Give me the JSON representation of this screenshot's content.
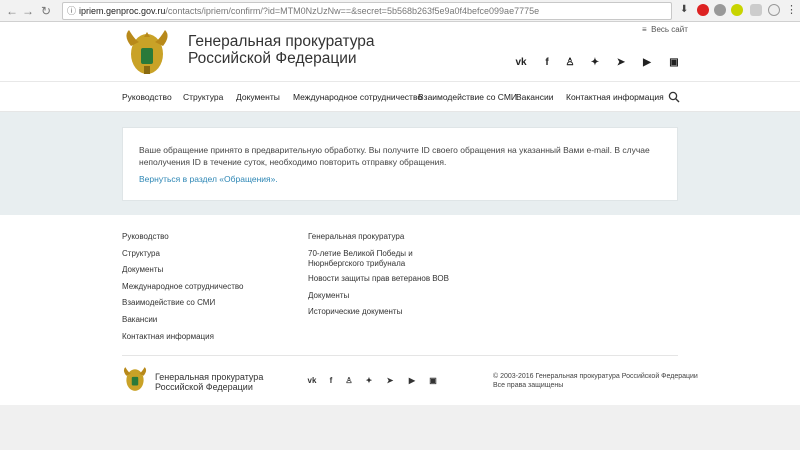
{
  "browser": {
    "url_domain": "ipriem.genproc.gov.ru",
    "url_path": "/contacts/ipriem/confirm/?id=MTM0NzUzNw==&secret=5b568b263f5e9a0f4befce099ae7775e"
  },
  "header": {
    "title_line1": "Генеральная прокуратура",
    "title_line2": "Российской Федерации",
    "all_sites": "Весь сайт"
  },
  "nav": {
    "items": [
      {
        "label": "Руководство"
      },
      {
        "label": "Структура"
      },
      {
        "label": "Документы"
      },
      {
        "label": "Международное сотрудничество"
      },
      {
        "label": "Взаимодействие со СМИ"
      },
      {
        "label": "Вакансии"
      },
      {
        "label": "Контактная информация"
      }
    ]
  },
  "content": {
    "message": "Ваше обращение принято в предварительную обработку. Вы получите ID своего обращения на указанный Вами e-mail. В случае неполучения ID в течение суток, необходимо повторить отправку обращения.",
    "back_link": "Вернуться в раздел «Обращения»."
  },
  "footer": {
    "col1": [
      {
        "label": "Руководство"
      },
      {
        "label": "Структура"
      },
      {
        "label": "Документы"
      },
      {
        "label": "Международное сотрудничество"
      },
      {
        "label": "Взаимодействие со СМИ"
      },
      {
        "label": "Вакансии"
      },
      {
        "label": "Контактная информация"
      }
    ],
    "col2": [
      {
        "label": "Генеральная прокуратура"
      },
      {
        "label": "70-летие Великой Победы и Нюрнбергского трибунала"
      },
      {
        "label": "Новости защиты прав ветеранов ВОВ"
      },
      {
        "label": "Документы"
      },
      {
        "label": "Исторические документы"
      }
    ],
    "title_line1": "Генеральная прокуратура",
    "title_line2": "Российской Федерации",
    "copyright_line1": "© 2003-2016 Генеральная прокуратура Российской Федерации",
    "copyright_line2": "Все права защищены"
  },
  "social": [
    "vk-icon",
    "facebook-icon",
    "odnoklassniki-icon",
    "twitter-icon",
    "telegram-icon",
    "youtube-icon",
    "instagram-icon"
  ],
  "colors": {
    "accent": "#2e87b5",
    "content_bg": "#e8eef0"
  }
}
